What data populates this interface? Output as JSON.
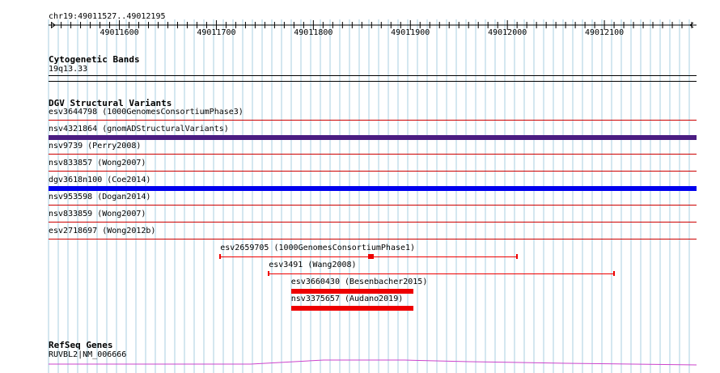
{
  "ruler": {
    "location": "chr19:49011527..49012195",
    "start": 49011527,
    "end": 49012195,
    "ticks": [
      "49011600",
      "49011700",
      "49011800",
      "49011900",
      "49012000",
      "49012100"
    ]
  },
  "cytoband": {
    "title": "Cytogenetic Bands",
    "band": "19q13.33"
  },
  "dgv": {
    "title": "DGV Structural Variants",
    "full_rows": [
      {
        "label": "esv3644798 (1000GenomesConsortiumPhase3)",
        "color": "#cc0000",
        "thick": false
      },
      {
        "label": "nsv4321864 (gnomADStructuralVariants)",
        "color": "#4b1d82",
        "thick": true
      },
      {
        "label": "nsv9739 (Perry2008)",
        "color": "#cc0000",
        "thick": false
      },
      {
        "label": "nsv833857 (Wong2007)",
        "color": "#cc0000",
        "thick": false
      },
      {
        "label": "dgv3618n100 (Coe2014)",
        "color": "#0000ee",
        "thick": true
      },
      {
        "label": "nsv953598 (Dogan2014)",
        "color": "#cc0000",
        "thick": false
      },
      {
        "label": "nsv833859 (Wong2007)",
        "color": "#cc0000",
        "thick": false
      },
      {
        "label": "esv2718697 (Wong2012b)",
        "color": "#cc0000",
        "thick": false
      }
    ],
    "partial_rows": [
      {
        "label": "esv2659705 (1000GenomesConsortiumPhase1)",
        "start": 49011704,
        "end": 49012010,
        "style": "span",
        "color": "#ee0000"
      },
      {
        "label": "esv3491 (Wang2008)",
        "start": 49011754,
        "end": 49012110,
        "style": "span",
        "color": "#ee0000"
      },
      {
        "label": "esv3660430 (Besenbacher2015)",
        "start": 49011777,
        "end": 49011903,
        "style": "block",
        "color": "#ee0000"
      },
      {
        "label": "nsv3375657 (Audano2019)",
        "start": 49011777,
        "end": 49011903,
        "style": "block",
        "color": "#ee0000"
      }
    ]
  },
  "refseq": {
    "title": "RefSeq Genes",
    "gene": "RUVBL2|NM_006666",
    "color": "#cc44cc"
  }
}
